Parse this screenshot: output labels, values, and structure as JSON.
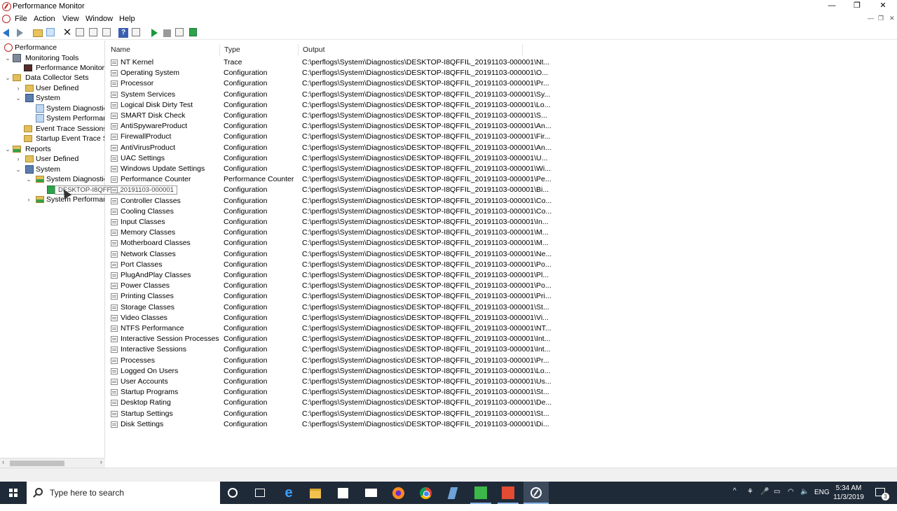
{
  "window": {
    "title": "Performance Monitor",
    "controls": {
      "minimize": "—",
      "restore": "❐",
      "close": "✕"
    }
  },
  "menu": [
    "File",
    "Action",
    "View",
    "Window",
    "Help"
  ],
  "tree": [
    {
      "label": "Performance",
      "icon": "perf-icon",
      "expander": ""
    },
    {
      "label": "Monitoring Tools",
      "icon": "tools-icon",
      "expander": "⌄"
    },
    {
      "label": "Performance Monitor",
      "icon": "monitor-icon",
      "expander": ""
    },
    {
      "label": "Data Collector Sets",
      "icon": "folder-icon",
      "expander": "⌄"
    },
    {
      "label": "User Defined",
      "icon": "folder-icon",
      "expander": "›"
    },
    {
      "label": "System",
      "icon": "system-folder-icon",
      "expander": "⌄"
    },
    {
      "label": "System Diagnostics",
      "icon": "diagnostics-icon",
      "expander": ""
    },
    {
      "label": "System Performanc",
      "icon": "diagnostics-icon",
      "expander": ""
    },
    {
      "label": "Event Trace Sessions",
      "icon": "folder-icon",
      "expander": ""
    },
    {
      "label": "Startup Event Trace Sess",
      "icon": "folder-icon",
      "expander": ""
    },
    {
      "label": "Reports",
      "icon": "reports-icon",
      "expander": "⌄"
    },
    {
      "label": "User Defined",
      "icon": "folder-icon",
      "expander": "›"
    },
    {
      "label": "System",
      "icon": "system-folder-icon",
      "expander": "⌄"
    },
    {
      "label": "System Diagnostics",
      "icon": "green-folder-icon",
      "expander": "⌄"
    },
    {
      "label": "",
      "icon": "report-icon",
      "expander": ""
    },
    {
      "label": "System Performanc",
      "icon": "green-folder-icon",
      "expander": "›"
    }
  ],
  "tooltip": "DESKTOP-I8QFFIL_20191103-000001",
  "columns": {
    "name": "Name",
    "type": "Type",
    "output": "Output"
  },
  "rows": [
    {
      "name": "NT Kernel",
      "type": "Trace",
      "output": "C:\\perflogs\\System\\Diagnostics\\DESKTOP-I8QFFIL_20191103-000001\\Nt..."
    },
    {
      "name": "Operating System",
      "type": "Configuration",
      "output": "C:\\perflogs\\System\\Diagnostics\\DESKTOP-I8QFFIL_20191103-000001\\O..."
    },
    {
      "name": "Processor",
      "type": "Configuration",
      "output": "C:\\perflogs\\System\\Diagnostics\\DESKTOP-I8QFFIL_20191103-000001\\Pr..."
    },
    {
      "name": "System Services",
      "type": "Configuration",
      "output": "C:\\perflogs\\System\\Diagnostics\\DESKTOP-I8QFFIL_20191103-000001\\Sy..."
    },
    {
      "name": "Logical Disk Dirty Test",
      "type": "Configuration",
      "output": "C:\\perflogs\\System\\Diagnostics\\DESKTOP-I8QFFIL_20191103-000001\\Lo..."
    },
    {
      "name": "SMART Disk Check",
      "type": "Configuration",
      "output": "C:\\perflogs\\System\\Diagnostics\\DESKTOP-I8QFFIL_20191103-000001\\S..."
    },
    {
      "name": "AntiSpywareProduct",
      "type": "Configuration",
      "output": "C:\\perflogs\\System\\Diagnostics\\DESKTOP-I8QFFIL_20191103-000001\\An..."
    },
    {
      "name": "FirewallProduct",
      "type": "Configuration",
      "output": "C:\\perflogs\\System\\Diagnostics\\DESKTOP-I8QFFIL_20191103-000001\\Fir..."
    },
    {
      "name": "AntiVirusProduct",
      "type": "Configuration",
      "output": "C:\\perflogs\\System\\Diagnostics\\DESKTOP-I8QFFIL_20191103-000001\\An..."
    },
    {
      "name": "UAC Settings",
      "type": "Configuration",
      "output": "C:\\perflogs\\System\\Diagnostics\\DESKTOP-I8QFFIL_20191103-000001\\U..."
    },
    {
      "name": "Windows Update Settings",
      "type": "Configuration",
      "output": "C:\\perflogs\\System\\Diagnostics\\DESKTOP-I8QFFIL_20191103-000001\\Wi..."
    },
    {
      "name": "Performance Counter",
      "type": "Performance Counter",
      "output": "C:\\perflogs\\System\\Diagnostics\\DESKTOP-I8QFFIL_20191103-000001\\Pe..."
    },
    {
      "name": "",
      "type": "Configuration",
      "output": "C:\\perflogs\\System\\Diagnostics\\DESKTOP-I8QFFIL_20191103-000001\\Bi..."
    },
    {
      "name": "Controller Classes",
      "type": "Configuration",
      "output": "C:\\perflogs\\System\\Diagnostics\\DESKTOP-I8QFFIL_20191103-000001\\Co..."
    },
    {
      "name": "Cooling Classes",
      "type": "Configuration",
      "output": "C:\\perflogs\\System\\Diagnostics\\DESKTOP-I8QFFIL_20191103-000001\\Co..."
    },
    {
      "name": "Input Classes",
      "type": "Configuration",
      "output": "C:\\perflogs\\System\\Diagnostics\\DESKTOP-I8QFFIL_20191103-000001\\In..."
    },
    {
      "name": "Memory Classes",
      "type": "Configuration",
      "output": "C:\\perflogs\\System\\Diagnostics\\DESKTOP-I8QFFIL_20191103-000001\\M..."
    },
    {
      "name": "Motherboard Classes",
      "type": "Configuration",
      "output": "C:\\perflogs\\System\\Diagnostics\\DESKTOP-I8QFFIL_20191103-000001\\M..."
    },
    {
      "name": "Network Classes",
      "type": "Configuration",
      "output": "C:\\perflogs\\System\\Diagnostics\\DESKTOP-I8QFFIL_20191103-000001\\Ne..."
    },
    {
      "name": "Port Classes",
      "type": "Configuration",
      "output": "C:\\perflogs\\System\\Diagnostics\\DESKTOP-I8QFFIL_20191103-000001\\Po..."
    },
    {
      "name": "PlugAndPlay Classes",
      "type": "Configuration",
      "output": "C:\\perflogs\\System\\Diagnostics\\DESKTOP-I8QFFIL_20191103-000001\\Pl..."
    },
    {
      "name": "Power Classes",
      "type": "Configuration",
      "output": "C:\\perflogs\\System\\Diagnostics\\DESKTOP-I8QFFIL_20191103-000001\\Po..."
    },
    {
      "name": "Printing Classes",
      "type": "Configuration",
      "output": "C:\\perflogs\\System\\Diagnostics\\DESKTOP-I8QFFIL_20191103-000001\\Pri..."
    },
    {
      "name": "Storage Classes",
      "type": "Configuration",
      "output": "C:\\perflogs\\System\\Diagnostics\\DESKTOP-I8QFFIL_20191103-000001\\St..."
    },
    {
      "name": "Video Classes",
      "type": "Configuration",
      "output": "C:\\perflogs\\System\\Diagnostics\\DESKTOP-I8QFFIL_20191103-000001\\Vi..."
    },
    {
      "name": "NTFS Performance",
      "type": "Configuration",
      "output": "C:\\perflogs\\System\\Diagnostics\\DESKTOP-I8QFFIL_20191103-000001\\NT..."
    },
    {
      "name": "Interactive Session Processes",
      "type": "Configuration",
      "output": "C:\\perflogs\\System\\Diagnostics\\DESKTOP-I8QFFIL_20191103-000001\\Int..."
    },
    {
      "name": "Interactive Sessions",
      "type": "Configuration",
      "output": "C:\\perflogs\\System\\Diagnostics\\DESKTOP-I8QFFIL_20191103-000001\\Int..."
    },
    {
      "name": "Processes",
      "type": "Configuration",
      "output": "C:\\perflogs\\System\\Diagnostics\\DESKTOP-I8QFFIL_20191103-000001\\Pr..."
    },
    {
      "name": "Logged On Users",
      "type": "Configuration",
      "output": "C:\\perflogs\\System\\Diagnostics\\DESKTOP-I8QFFIL_20191103-000001\\Lo..."
    },
    {
      "name": "User Accounts",
      "type": "Configuration",
      "output": "C:\\perflogs\\System\\Diagnostics\\DESKTOP-I8QFFIL_20191103-000001\\Us..."
    },
    {
      "name": "Startup Programs",
      "type": "Configuration",
      "output": "C:\\perflogs\\System\\Diagnostics\\DESKTOP-I8QFFIL_20191103-000001\\St..."
    },
    {
      "name": "Desktop Rating",
      "type": "Configuration",
      "output": "C:\\perflogs\\System\\Diagnostics\\DESKTOP-I8QFFIL_20191103-000001\\De..."
    },
    {
      "name": "Startup Settings",
      "type": "Configuration",
      "output": "C:\\perflogs\\System\\Diagnostics\\DESKTOP-I8QFFIL_20191103-000001\\St..."
    },
    {
      "name": "Disk Settings",
      "type": "Configuration",
      "output": "C:\\perflogs\\System\\Diagnostics\\DESKTOP-I8QFFIL_20191103-000001\\Di..."
    }
  ],
  "taskbar": {
    "search_placeholder": "Type here to search",
    "language": "ENG",
    "time": "5:34 AM",
    "date": "11/3/2019",
    "notification_count": "3",
    "apps": [
      "cortana-icon",
      "task-view-icon",
      "edge-icon",
      "file-explorer-icon",
      "store-icon",
      "mail-icon",
      "firefox-icon",
      "chrome-icon",
      "feather-app-icon",
      "camtasia-green-icon",
      "camtasia-red-icon",
      "performance-monitor-icon"
    ],
    "tray": {
      "chevron": "^",
      "network": "⚘",
      "mic": "🎤",
      "battery": "▭",
      "wifi": "◠",
      "volume": "🔈"
    }
  },
  "colors": {
    "accent": "#2a74c9",
    "taskbar": "#1f2a38",
    "green": "#2ea34a"
  }
}
